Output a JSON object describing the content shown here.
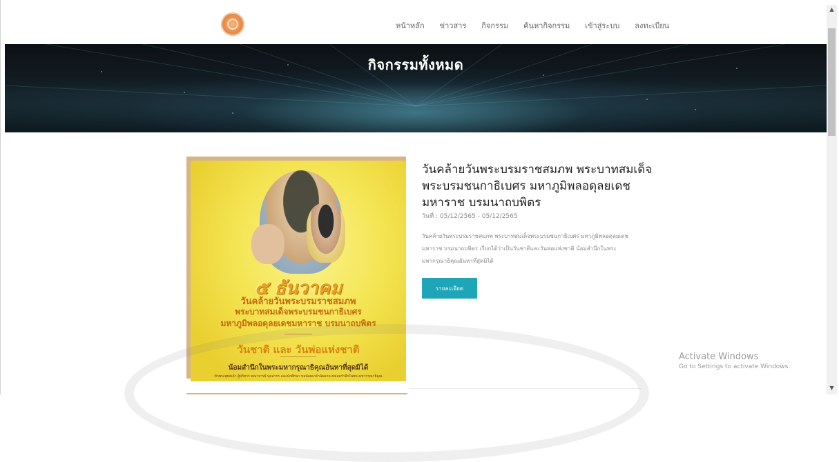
{
  "nav": {
    "items": [
      {
        "label": "หน้าหลัก"
      },
      {
        "label": "ข่าวสาร"
      },
      {
        "label": "กิจกรรม"
      },
      {
        "label": "ค้นหากิจกรรม"
      },
      {
        "label": "เข้าสู่ระบบ"
      },
      {
        "label": "ลงทะเบียน"
      }
    ]
  },
  "hero": {
    "title": "กิจกรรมทั้งหมด"
  },
  "article": {
    "title": "วันคล้ายวันพระบรมราชสมภพ พระบาทสมเด็จพระบรมชนกาธิเบศร มหาภูมิพลอดุลยเดชมหาราช บรมนาถบพิตร",
    "date": "วันที่ : 05/12/2565 - 05/12/2565",
    "body": "วันคล้ายวันพระบรมราชสมภพ พระบาทสมเด็จพระบรมชนกาธิเบศร มหาภูมิพลอดุลยเดชมหาราช บรมนาถบพิตร เรียกได้ว่าเป็นวันชาติและวันพ่อแห่งชาติ น้อมสำนึกในพระมหากรุณาธิคุณอันหาที่สุดมิได้",
    "button_label": "รายละเอียด",
    "poster": {
      "line1": "๕ ธันวาคม",
      "line2": "วันคล้ายวันพระบรมราชสมภพ",
      "line3": "พระบาทสมเด็จพระบรมชนกาธิเบศร",
      "line4": "มหาภูมิพลอดุลยเดชมหาราช บรมนาถบพิตร",
      "line5": "วันชาติ และ วันพ่อแห่งชาติ",
      "line6": "น้อมสำนึกในพระมหากรุณาธิคุณอันหาที่สุดมิได้",
      "line7": "ข้าพระพุทธเจ้า ผู้บริหาร คณาจารย์ บุคลากร และนักศึกษา ขอน้อมเกล้าน้อมกระหม่อมรำลึกในพระมหากรุณาธิคุณ"
    }
  },
  "activate": {
    "title": "Activate Windows",
    "subtitle": "Go to Settings to activate Windows."
  },
  "colors": {
    "button": "#1ea6b8",
    "hero_bg": "#0c1014",
    "poster_bg": "#f4e452",
    "poster_text": "#c56a0b"
  }
}
